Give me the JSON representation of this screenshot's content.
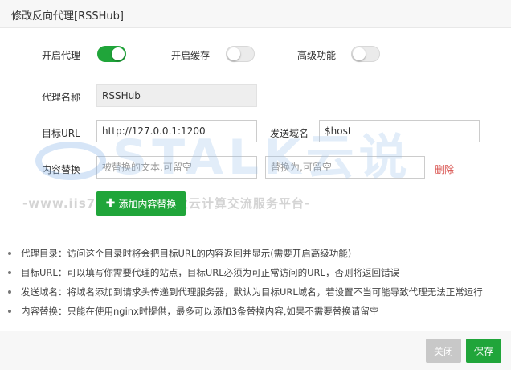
{
  "dialog": {
    "title": "修改反向代理[RSSHub]"
  },
  "switches": {
    "proxy": {
      "label": "开启代理",
      "on": true
    },
    "cache": {
      "label": "开启缓存",
      "on": false
    },
    "advanced": {
      "label": "高级功能",
      "on": false
    }
  },
  "form": {
    "proxy_name_label": "代理名称",
    "proxy_name_value": "RSSHub",
    "target_url_label": "目标URL",
    "target_url_value": "http://127.0.0.1:1200",
    "send_domain_label": "发送域名",
    "send_domain_value": "$host",
    "replace_label": "内容替换",
    "replace_from_placeholder": "被替换的文本,可留空",
    "replace_to_placeholder": "替换为,可留空",
    "delete_label": "删除",
    "add_replace_label": "添加内容替换"
  },
  "watermark": {
    "brand": "STALK云说",
    "line": "-www.iis7.com-国内专业云计算交流服务平台-"
  },
  "notes": [
    "代理目录：访问这个目录时将会把目标URL的内容返回并显示(需要开启高级功能)",
    "目标URL：可以填写你需要代理的站点，目标URL必须为可正常访问的URL，否则将返回错误",
    "发送域名：将域名添加到请求头传递到代理服务器，默认为目标URL域名，若设置不当可能导致代理无法正常运行",
    "内容替换：只能在使用nginx时提供，最多可以添加3条替换内容,如果不需要替换请留空"
  ],
  "footer": {
    "close_label": "关闭",
    "save_label": "保存"
  },
  "colors": {
    "accent": "#20a53a",
    "delete": "#d9534f",
    "disabled": "#c8c8c8"
  }
}
